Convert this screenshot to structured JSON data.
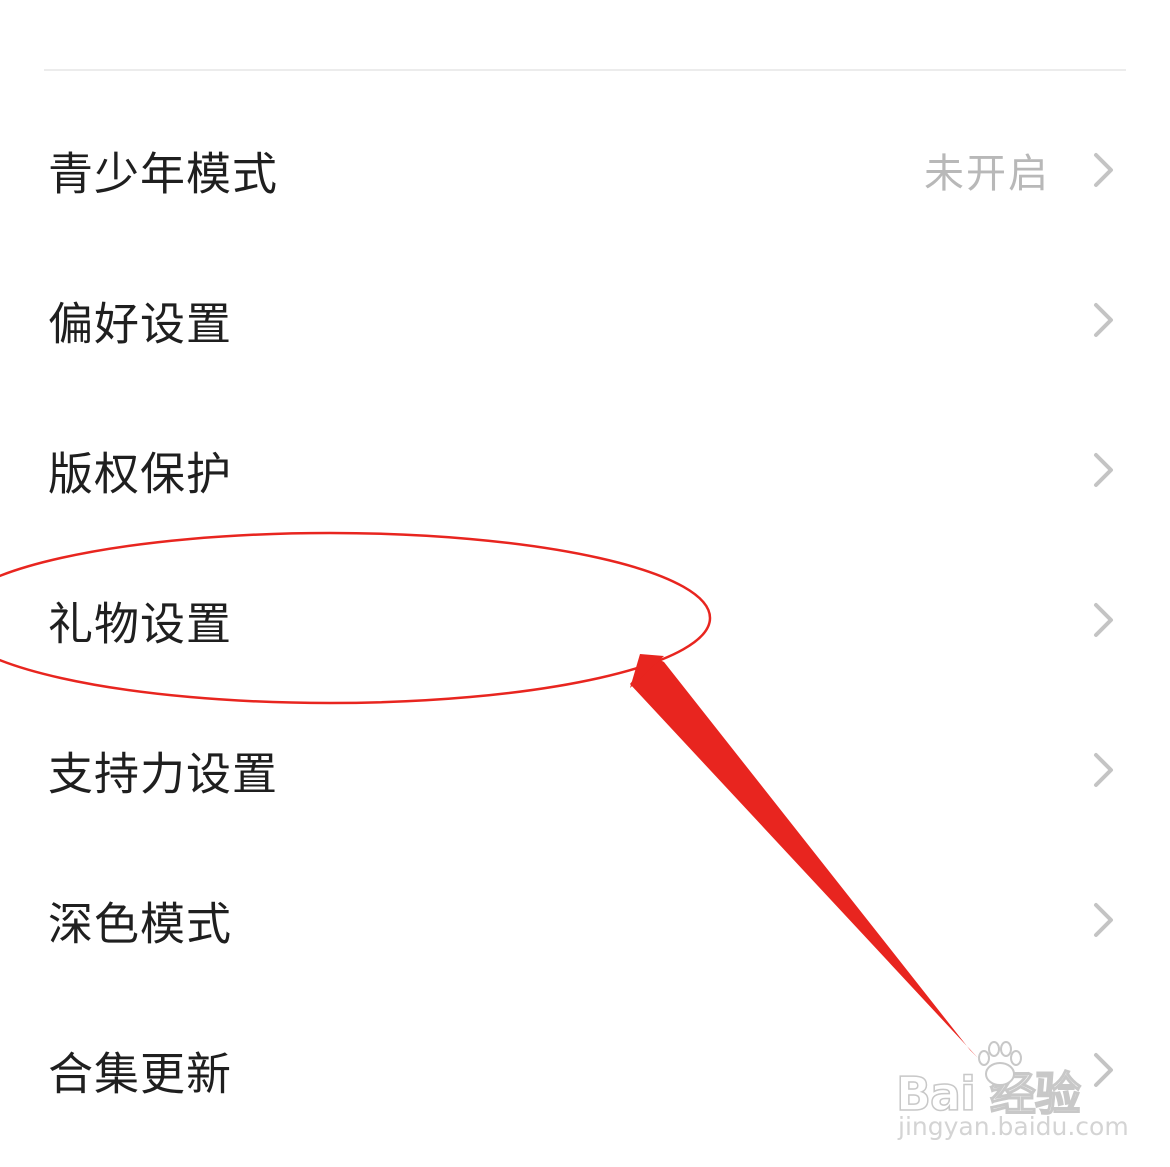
{
  "settings": {
    "items": [
      {
        "label": "青少年模式",
        "value": "未开启",
        "icon": "chevron-right-icon"
      },
      {
        "label": "偏好设置",
        "value": "",
        "icon": "chevron-right-icon"
      },
      {
        "label": "版权保护",
        "value": "",
        "icon": "chevron-right-icon"
      },
      {
        "label": "礼物设置",
        "value": "",
        "icon": "chevron-right-icon"
      },
      {
        "label": "支持力设置",
        "value": "",
        "icon": "chevron-right-icon"
      },
      {
        "label": "深色模式",
        "value": "",
        "icon": "chevron-right-icon"
      },
      {
        "label": "合集更新",
        "value": "",
        "icon": "chevron-right-icon"
      }
    ]
  },
  "annotation": {
    "highlighted_item": "礼物设置",
    "color": "#e8251f"
  },
  "watermark": {
    "logo_text": "Bai  经验",
    "url": "jingyan.baidu.com"
  },
  "colors": {
    "background": "#ffffff",
    "label_text": "#1f1f1f",
    "value_text": "#b8b8b8",
    "chevron": "#c4c4c4",
    "divider": "#ececec"
  }
}
